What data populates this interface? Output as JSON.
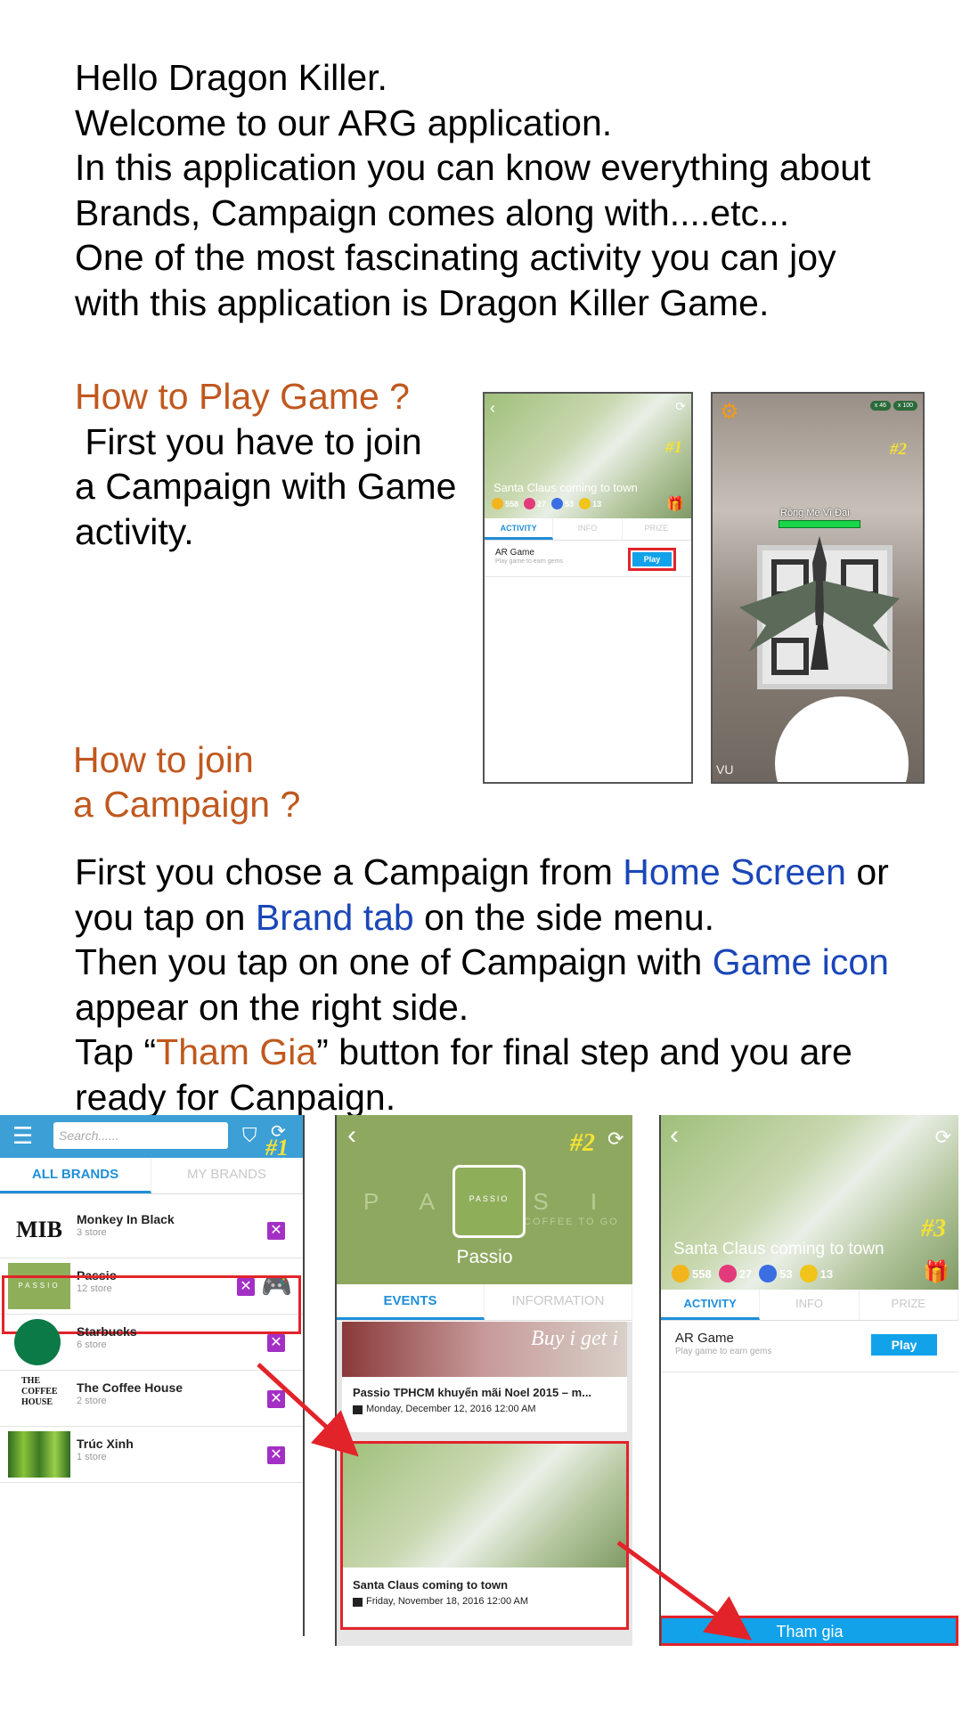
{
  "intro": {
    "lines": [
      "Hello Dragon Killer.",
      "Welcome to our ARG application.",
      "In this application you can know everything about",
      "Brands, Campaign comes along with....etc...",
      "One of the most fascinating activity you can joy",
      "with this application is Dragon Killer Game."
    ]
  },
  "play_section": {
    "heading": "How to Play Game ?",
    "lines": [
      " First you have to join",
      "a Campaign with Game",
      "activity."
    ]
  },
  "join_section": {
    "heading_1": "How to join",
    "heading_2": "a Campaign ?"
  },
  "steps": {
    "l1_a": "First you chose a Campaign from ",
    "l1_b": "Home Screen",
    "l1_c": " or",
    "l2_a": "you tap on ",
    "l2_b": "Brand tab",
    "l2_c": " on the side menu.",
    "l3_a": "Then you tap on one of Campaign with ",
    "l3_b": "Game icon",
    "l4": "appear on the right side.",
    "l5_a": "Tap “",
    "l5_b": "Tham Gia",
    "l5_c": "” button for final step and you are",
    "l6": "ready for Canpaign."
  },
  "shot_campaign_small": {
    "tag": "#1",
    "title": "Santa Claus coming to town",
    "gems": [
      "558",
      "27",
      "53",
      "13"
    ],
    "tabs": [
      "ACTIVITY",
      "INFO",
      "PRIZE"
    ],
    "item_title": "AR Game",
    "item_sub": "Play game to earn gems",
    "button": "Play"
  },
  "shot_ar": {
    "tag": "#2",
    "dragon_name": "Rồng Mẹ Vĩ Đại",
    "counter_1": "x 46",
    "counter_2": "x 100",
    "watermark": "VU"
  },
  "shot_brands": {
    "tag": "#1",
    "search_placeholder": "Search......",
    "tabs": [
      "ALL BRANDS",
      "MY BRANDS"
    ],
    "brands": [
      {
        "name": "Monkey In Black",
        "stores": "3 store",
        "logo_text": "MIB"
      },
      {
        "name": "Passio",
        "stores": "12 store",
        "logo_text": "PASSIO"
      },
      {
        "name": "Starbucks",
        "stores": "6 store",
        "logo_text": ""
      },
      {
        "name": "The Coffee House",
        "stores": "2 store",
        "logo_text": "THE COFFEE HOUSE"
      },
      {
        "name": "Trúc Xinh",
        "stores": "1 store",
        "logo_text": ""
      }
    ]
  },
  "shot_brand_detail": {
    "tag": "#2",
    "bg_text": "P A S S I O",
    "bg_sub": "COFFEE TO GO",
    "logo_text": "PASSIO",
    "brand_name": "Passio",
    "tabs": [
      "EVENTS",
      "INFORMATION"
    ],
    "event_1": {
      "title": "Passio TPHCM khuyến mãi Noel 2015 – m...",
      "date": "Monday, December 12, 2016 12:00 AM",
      "overlay": "Buy i get i"
    },
    "event_2": {
      "title": "Santa Claus coming to town",
      "date": "Friday, November 18, 2016 12:00 AM"
    }
  },
  "shot_campaign_large": {
    "tag": "#3",
    "title": "Santa Claus coming to town",
    "gems": [
      "558",
      "27",
      "53",
      "13"
    ],
    "tabs": [
      "ACTIVITY",
      "INFO",
      "PRIZE"
    ],
    "item_title": "AR Game",
    "item_sub": "Play game to earn gems",
    "button": "Play",
    "join_button": "Tham gia"
  },
  "colors": {
    "heading": "#c0581e",
    "link_blue": "#1a46b8",
    "accent_blue": "#11a2ea",
    "highlight_red": "#e2232a",
    "tag_yellow": "#f5e233"
  }
}
